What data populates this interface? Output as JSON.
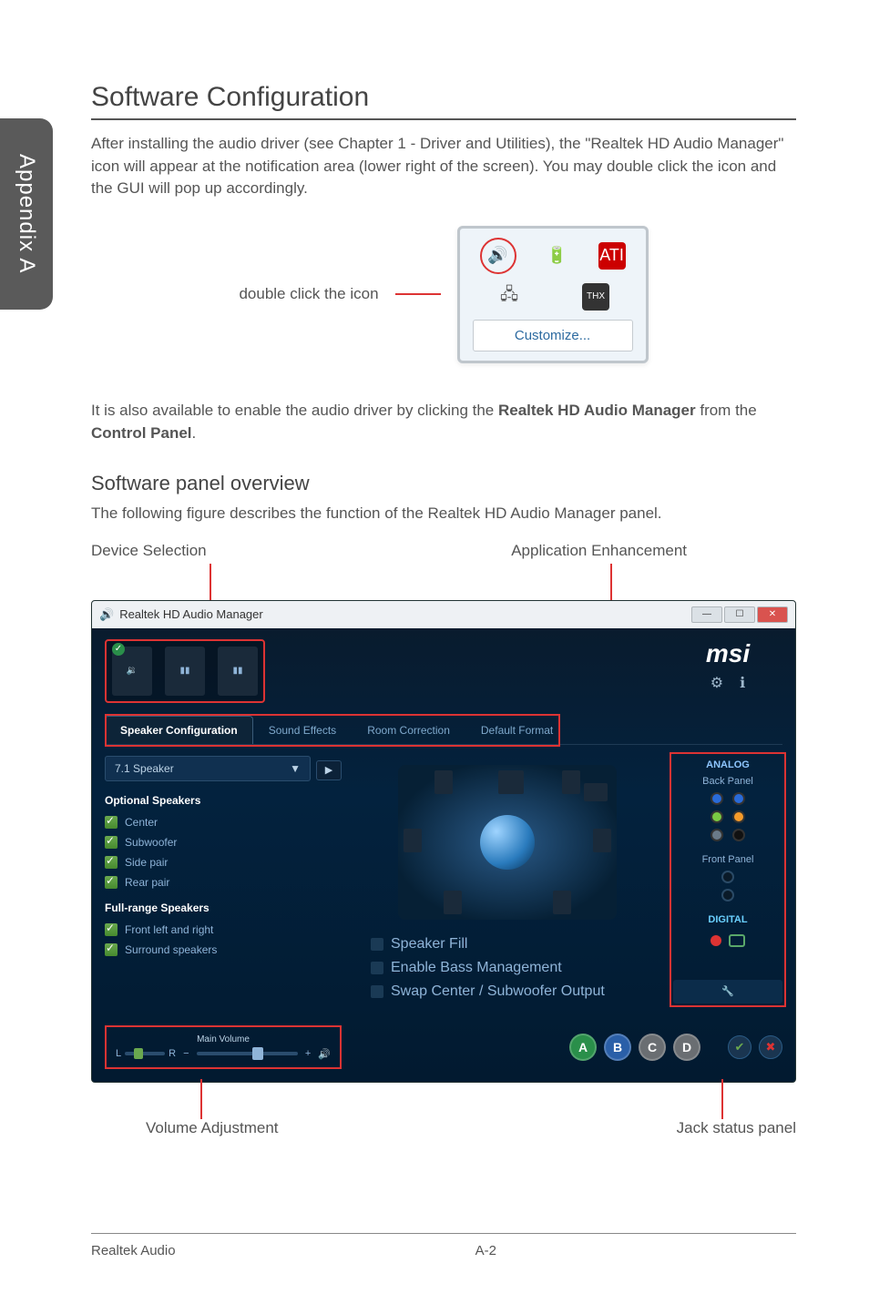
{
  "sideTab": "Appendix A",
  "sectionTitle": "Software Configuration",
  "intro": "After installing the audio driver (see Chapter 1 - Driver and Utilities), the \"Realtek HD Audio Manager\" icon will appear at the notification area (lower right of the screen). You may double click the icon and the GUI will pop up accordingly.",
  "trayLabel": "double click the icon",
  "customizeBtn": "Customize...",
  "enableLine_pre": "It is also available to enable the audio driver by clicking the ",
  "enableLine_bold1": "Realtek HD Audio Manager",
  "enableLine_mid": " from the ",
  "enableLine_bold2": "Control Panel",
  "enableLine_post": ".",
  "subhead": "Software panel overview",
  "subDesc": "The following figure describes the function of the Realtek HD Audio Manager panel.",
  "callouts": {
    "deviceSelection": "Device Selection",
    "appEnhancement": "Application Enhancement",
    "volumeAdjustment": "Volume Adjustment",
    "jackStatus": "Jack status panel"
  },
  "panel": {
    "windowTitle": "Realtek HD Audio Manager",
    "brand": "msi",
    "tabs": {
      "speakerConfig": "Speaker Configuration",
      "soundEffects": "Sound Effects",
      "roomCorrection": "Room Correction",
      "defaultFormat": "Default Format"
    },
    "speakerDropdown": "7.1 Speaker",
    "groups": {
      "optional": "Optional Speakers",
      "fullRange": "Full-range Speakers"
    },
    "optionalItems": {
      "center": "Center",
      "subwoofer": "Subwoofer",
      "sidePair": "Side pair",
      "rearPair": "Rear pair"
    },
    "fullRangeItems": {
      "frontLR": "Front left and right",
      "surround": "Surround speakers"
    },
    "centerChecks": {
      "speakerFill": "Speaker Fill",
      "bassMgmt": "Enable Bass Management",
      "swapCenter": "Swap Center / Subwoofer Output"
    },
    "rightCol": {
      "analog": "ANALOG",
      "backPanel": "Back Panel",
      "frontPanel": "Front Panel",
      "digital": "DIGITAL"
    },
    "volume": {
      "label": "Main Volume",
      "L": "L",
      "R": "R",
      "minus": "−",
      "plus": "+"
    },
    "modes": {
      "A": "A",
      "B": "B",
      "C": "C",
      "D": "D"
    }
  },
  "footer": {
    "left": "Realtek Audio",
    "center": "A-2"
  }
}
